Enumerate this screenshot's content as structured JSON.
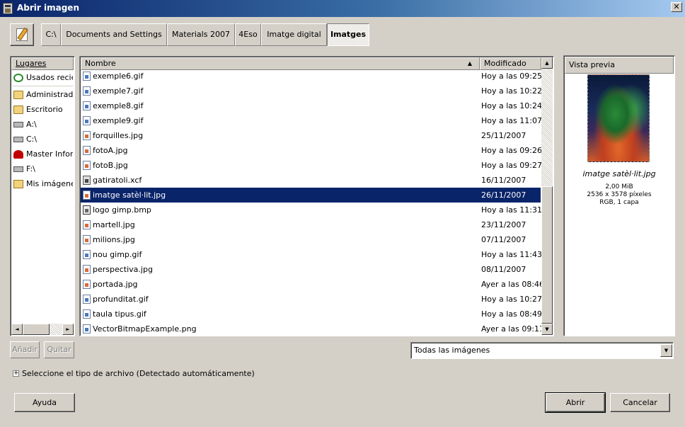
{
  "window": {
    "title": "Abrir imagen",
    "close_glyph": "✕"
  },
  "path_bar": {
    "buttons": [
      "C:\\",
      "Documents and Settings",
      "Materials 2007",
      "4Eso",
      "Imatge digital",
      "Imatges"
    ],
    "active_index": 5
  },
  "places": {
    "header": "Lugares",
    "items": [
      {
        "label": "Usados recientemente",
        "icon": "recent-icon"
      },
      {
        "label": "Administrador",
        "icon": "folder-icon"
      },
      {
        "label": "Escritorio",
        "icon": "folder-icon"
      },
      {
        "label": "A:\\",
        "icon": "floppy-drive-icon"
      },
      {
        "label": "C:\\",
        "icon": "hard-drive-icon"
      },
      {
        "label": "Master Informática",
        "icon": "master-icon"
      },
      {
        "label": "F:\\",
        "icon": "hard-drive-icon"
      },
      {
        "label": "Mis imágenes",
        "icon": "pictures-folder-icon"
      }
    ],
    "add_button": "Añadir",
    "remove_button": "Quitar"
  },
  "files": {
    "col_name": "Nombre",
    "col_modified": "Modificado",
    "sort_glyph": "▲",
    "rows": [
      {
        "name": "exemple6.gif",
        "modified": "Hoy a las 09:25",
        "type": "gif"
      },
      {
        "name": "exemple7.gif",
        "modified": "Hoy a las 10:22",
        "type": "gif"
      },
      {
        "name": "exemple8.gif",
        "modified": "Hoy a las 10:24",
        "type": "gif"
      },
      {
        "name": "exemple9.gif",
        "modified": "Hoy a las 11:07",
        "type": "gif"
      },
      {
        "name": "forquilles.jpg",
        "modified": "25/11/2007",
        "type": "jpg"
      },
      {
        "name": "fotoA.jpg",
        "modified": "Hoy a las 09:26",
        "type": "jpg"
      },
      {
        "name": "fotoB.jpg",
        "modified": "Hoy a las 09:27",
        "type": "jpg"
      },
      {
        "name": "gatiratoli.xcf",
        "modified": "16/11/2007",
        "type": "xcf"
      },
      {
        "name": "imatge satèl·lit.jpg",
        "modified": "26/11/2007",
        "type": "jpg",
        "selected": true
      },
      {
        "name": "logo gimp.bmp",
        "modified": "Hoy a las 11:31",
        "type": "bmp"
      },
      {
        "name": "martell.jpg",
        "modified": "23/11/2007",
        "type": "jpg"
      },
      {
        "name": "milions.jpg",
        "modified": "07/11/2007",
        "type": "jpg"
      },
      {
        "name": "nou gimp.gif",
        "modified": "Hoy a las 11:43",
        "type": "gif"
      },
      {
        "name": "perspectiva.jpg",
        "modified": "08/11/2007",
        "type": "jpg"
      },
      {
        "name": "portada.jpg",
        "modified": "Ayer a las 08:46",
        "type": "jpg"
      },
      {
        "name": "profunditat.gif",
        "modified": "Hoy a las 10:27",
        "type": "gif"
      },
      {
        "name": "taula tipus.gif",
        "modified": "Hoy a las 08:49",
        "type": "gif"
      },
      {
        "name": "VectorBitmapExample.png",
        "modified": "Ayer a las 09:11",
        "type": "png"
      }
    ]
  },
  "preview": {
    "header": "Vista previa",
    "filename": "imatge satèl·lit.jpg",
    "size": "2,00 MiB",
    "dimensions": "2536 x 3578 píxeles",
    "mode": "RGB, 1 capa"
  },
  "filter": {
    "selected": "Todas las imágenes",
    "arrow_glyph": "▼"
  },
  "file_type": {
    "expander_glyph": "+",
    "label": "Seleccione el tipo de archivo (Detectado automáticamente)"
  },
  "buttons": {
    "help": "Ayuda",
    "open": "Abrir",
    "cancel": "Cancelar"
  },
  "scroll_glyphs": {
    "up": "▲",
    "down": "▼",
    "left": "◄",
    "right": "►"
  },
  "colors": {
    "selection": "#0a246a",
    "titlebar_start": "#0a246a",
    "titlebar_end": "#a6caf0",
    "face": "#d4d0c8"
  }
}
